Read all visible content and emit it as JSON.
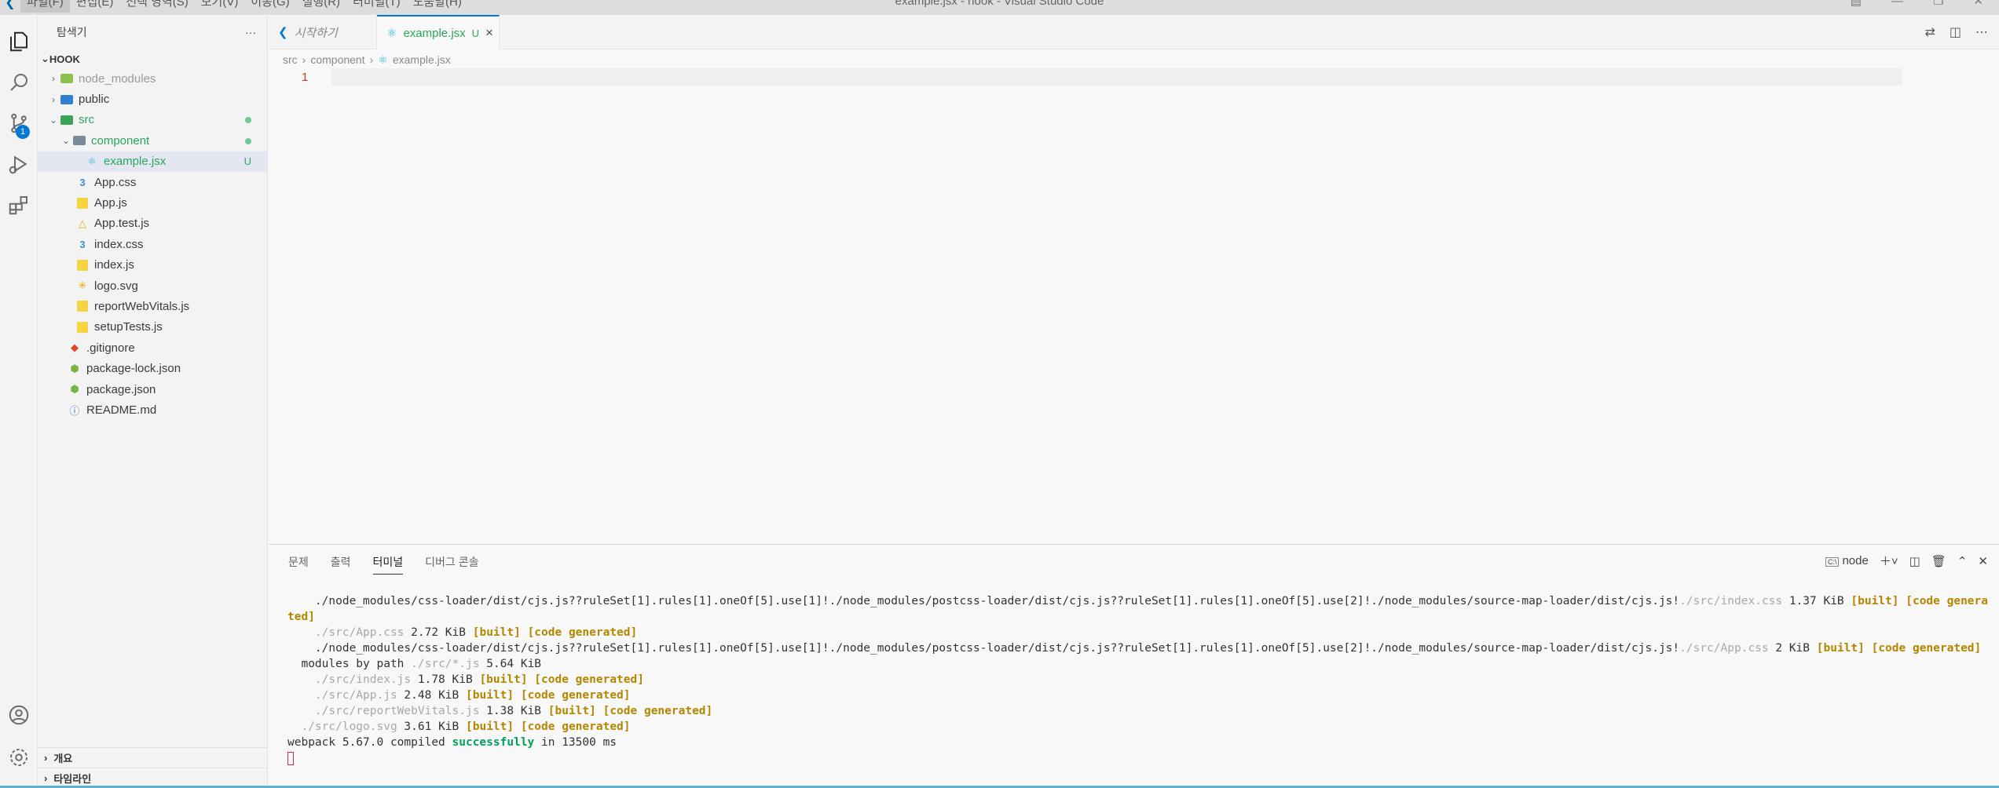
{
  "titlebar": {
    "menu": [
      "파일(F)",
      "편집(E)",
      "선택 영역(S)",
      "보기(V)",
      "이동(G)",
      "실행(R)",
      "터미널(T)",
      "도움말(H)"
    ],
    "title": "example.jsx - hook - Visual Studio Code"
  },
  "activity": {
    "scm_badge": "1"
  },
  "sidebar": {
    "header": "탐색기",
    "more": "···",
    "root": "HOOK",
    "items": [
      {
        "label": "node_modules"
      },
      {
        "label": "public"
      },
      {
        "label": "src"
      },
      {
        "label": "component"
      },
      {
        "label": "example.jsx",
        "deco": "U"
      },
      {
        "label": "App.css"
      },
      {
        "label": "App.js"
      },
      {
        "label": "App.test.js"
      },
      {
        "label": "index.css"
      },
      {
        "label": "index.js"
      },
      {
        "label": "logo.svg"
      },
      {
        "label": "reportWebVitals.js"
      },
      {
        "label": "setupTests.js"
      },
      {
        "label": ".gitignore"
      },
      {
        "label": "package-lock.json"
      },
      {
        "label": "package.json"
      },
      {
        "label": "README.md"
      }
    ],
    "outline": "개요",
    "timeline": "타임라인"
  },
  "tabs": {
    "welcome": "시작하기",
    "active": "example.jsx",
    "active_deco": "U"
  },
  "breadcrumb": {
    "a": "src",
    "b": "component",
    "c": "example.jsx"
  },
  "editor": {
    "line1": "1"
  },
  "panel": {
    "tabs": [
      "문제",
      "출력",
      "터미널",
      "디버그 콘솔"
    ],
    "shell": "node"
  },
  "terminal": {
    "l1a": "    ./node_modules/css-loader/dist/cjs.js??ruleSet[1].rules[1].oneOf[5].use[1]!./node_modules/postcss-loader/dist/cjs.js??ruleSet[1].rules[1].oneOf[5].use[2]!./node_modules/source-map-loader/dist/cjs.js!",
    "l1b": "./src/index.css",
    "l1c": " 1.37 KiB ",
    "l1d": "[built] [code generated]",
    "l2a": "    ./src/App.css",
    "l2b": " 2.72 KiB ",
    "l2c": "[built] [code generated]",
    "l3a": "    ./node_modules/css-loader/dist/cjs.js??ruleSet[1].rules[1].oneOf[5].use[1]!./node_modules/postcss-loader/dist/cjs.js??ruleSet[1].rules[1].oneOf[5].use[2]!./node_modules/source-map-loader/dist/cjs.js!",
    "l3b": "./src/App.css",
    "l3c": " 2 KiB ",
    "l3d": "[built] [code generated]",
    "l4a": "  modules by path ",
    "l4b": "./src/*.js",
    "l4c": " 5.64 KiB",
    "l5a": "    ./src/index.js",
    "l5b": " 1.78 KiB ",
    "l5c": "[built] [code generated]",
    "l6a": "    ./src/App.js",
    "l6b": " 2.48 KiB ",
    "l6c": "[built] [code generated]",
    "l7a": "    ./src/reportWebVitals.js",
    "l7b": " 1.38 KiB ",
    "l7c": "[built] [code generated]",
    "l8a": "  ./src/logo.svg",
    "l8b": " 3.61 KiB ",
    "l8c": "[built] [code generated]",
    "l9a": "webpack 5.67.0 compiled ",
    "l9b": "successfully",
    "l9c": " in 13500 ms"
  }
}
